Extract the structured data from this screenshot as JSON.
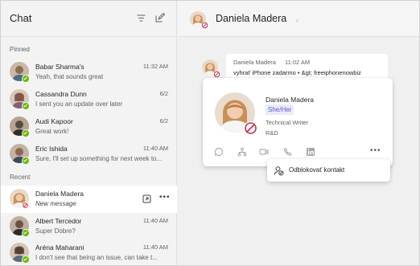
{
  "left": {
    "title": "Chat",
    "icons": {
      "filter": "filter-icon",
      "compose": "compose-icon"
    },
    "pinned_label": "Pinned",
    "recent_label": "Recent",
    "pinned": [
      {
        "name": "Babar Sharma's",
        "time": "11:32 AM",
        "preview": "Yeah, that sounds great",
        "presence": "available",
        "avatar_color": "#8a6b52"
      },
      {
        "name": "Cassandra Dunn",
        "time": "6/2",
        "preview": "I sent you an update over later",
        "presence": "available",
        "avatar_color": "#b28e7a"
      },
      {
        "name": "Audi Kapoor",
        "time": "6/2",
        "preview": "Great work!",
        "presence": "available",
        "avatar_color": "#5b4a3f"
      },
      {
        "name": "Eric Ishida",
        "time": "11:40 AM",
        "preview": "Sure, I'll set up something for next week to...",
        "presence": "available",
        "avatar_color": "#3f4a5b"
      }
    ],
    "recent": [
      {
        "name": "Daniela Madera",
        "time": "",
        "preview": "New message",
        "presence": "dnd",
        "avatar_color": "#d8b08a",
        "active": true
      },
      {
        "name": "Albert Tercedor",
        "time": "11:40 AM",
        "preview": "Super Dobre?",
        "presence": "available",
        "avatar_color": "#6b5245"
      },
      {
        "name": "Aréna Maharani",
        "time": "11:40 AM",
        "preview": "I don't see that being an issue, can take t...",
        "presence": "available",
        "avatar_color": "#9a7a6a"
      }
    ]
  },
  "right": {
    "header_name": "Daniela Madera",
    "header_dot": "›",
    "message": {
      "sender": "Daniela Madera",
      "time": "11:02 AM",
      "text": "vyhrať iPhone zadarmo • &gt; freeiphonenowbiz"
    },
    "card": {
      "name": "Daniela Madera",
      "pronouns": "She/Her",
      "title": "Technical Writer",
      "department": "R&D",
      "actions": [
        "chat-icon",
        "org-chart-icon",
        "video-icon",
        "call-icon",
        "linkedin-icon"
      ],
      "more": "•••"
    },
    "menu": {
      "item_label": "Odblokovať kontakt",
      "item_icon": "unblock-person-icon"
    }
  },
  "colors": {
    "accent": "#5b5fc7",
    "available": "#6bb700",
    "dnd": "#c4314b",
    "active_row": "#ffffff"
  }
}
